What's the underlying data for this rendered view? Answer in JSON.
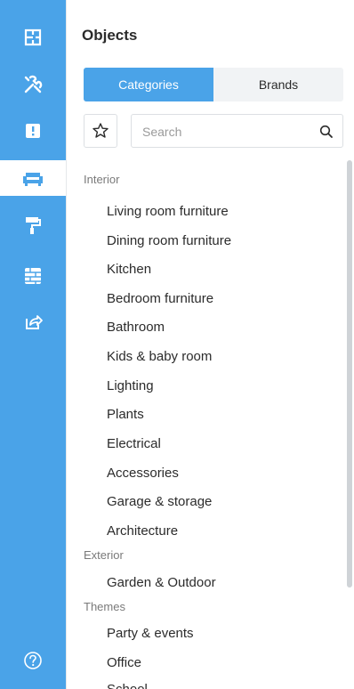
{
  "rail": {
    "items": [
      {
        "icon": "floor-plan-icon"
      },
      {
        "icon": "tools-icon"
      },
      {
        "icon": "info-icon"
      },
      {
        "icon": "sofa-icon",
        "active": true
      },
      {
        "icon": "paint-roller-icon"
      },
      {
        "icon": "wall-brick-icon"
      },
      {
        "icon": "share-icon"
      }
    ],
    "help_icon": "help-icon"
  },
  "panel": {
    "title": "Objects",
    "tabs": [
      {
        "label": "Categories",
        "active": true
      },
      {
        "label": "Brands",
        "active": false
      }
    ],
    "search_placeholder": "Search",
    "favorites_icon": "star-icon"
  },
  "sections": [
    {
      "header": "Interior",
      "items": [
        "Living room furniture",
        "Dining room furniture",
        "Kitchen",
        "Bedroom furniture",
        "Bathroom",
        "Kids & baby room",
        "Lighting",
        "Plants",
        "Electrical",
        "Accessories",
        "Garage & storage",
        "Architecture"
      ]
    },
    {
      "header": "Exterior",
      "items": [
        "Garden & Outdoor"
      ]
    },
    {
      "header": "Themes",
      "items": [
        "Party & events",
        "Office",
        "School"
      ]
    }
  ],
  "colors": {
    "accent": "#4aa3e8",
    "rail_bg": "#4aa3e8"
  }
}
